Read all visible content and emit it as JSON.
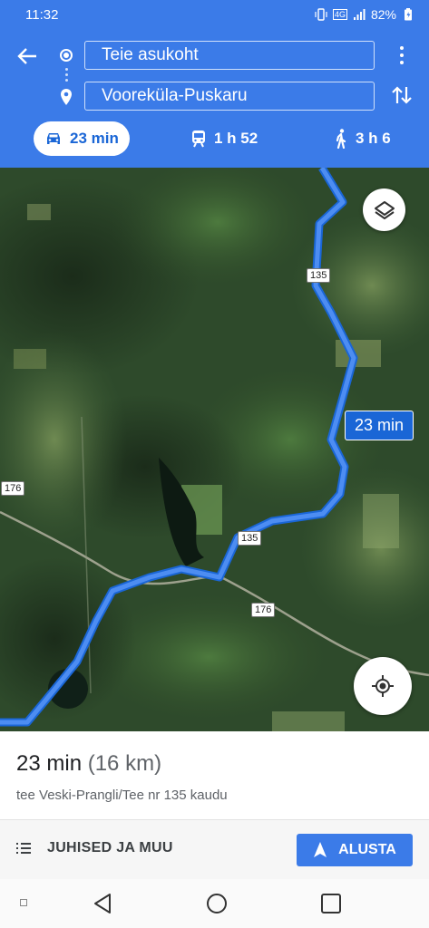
{
  "status_bar": {
    "time": "11:32",
    "network": "4G",
    "battery": "82%"
  },
  "header": {
    "origin": "Teie asukoht",
    "destination": "Voorekula-Puskaru",
    "destination_display": "Vooreküla-Puskaru",
    "modes": [
      {
        "id": "car",
        "label": "23 min",
        "icon": "car-icon",
        "active": true
      },
      {
        "id": "transit",
        "label": "1 h 52",
        "icon": "train-icon",
        "active": false
      },
      {
        "id": "walk",
        "label": "3 h 6",
        "icon": "walk-icon",
        "active": false
      }
    ]
  },
  "map": {
    "route_label": "23 min",
    "road_shields": [
      "135",
      "135",
      "176",
      "176"
    ],
    "route_color": "#3b7be8"
  },
  "summary": {
    "time": "23 min",
    "distance": "(16 km)",
    "via": "tee Veski-Prangli/Tee nr 135 kaudu"
  },
  "actions": {
    "steps_label": "JUHISED JA MUU",
    "start_label": "ALUSTA"
  },
  "colors": {
    "accent": "#3b7be8",
    "active_mode_text": "#1a66d6"
  }
}
